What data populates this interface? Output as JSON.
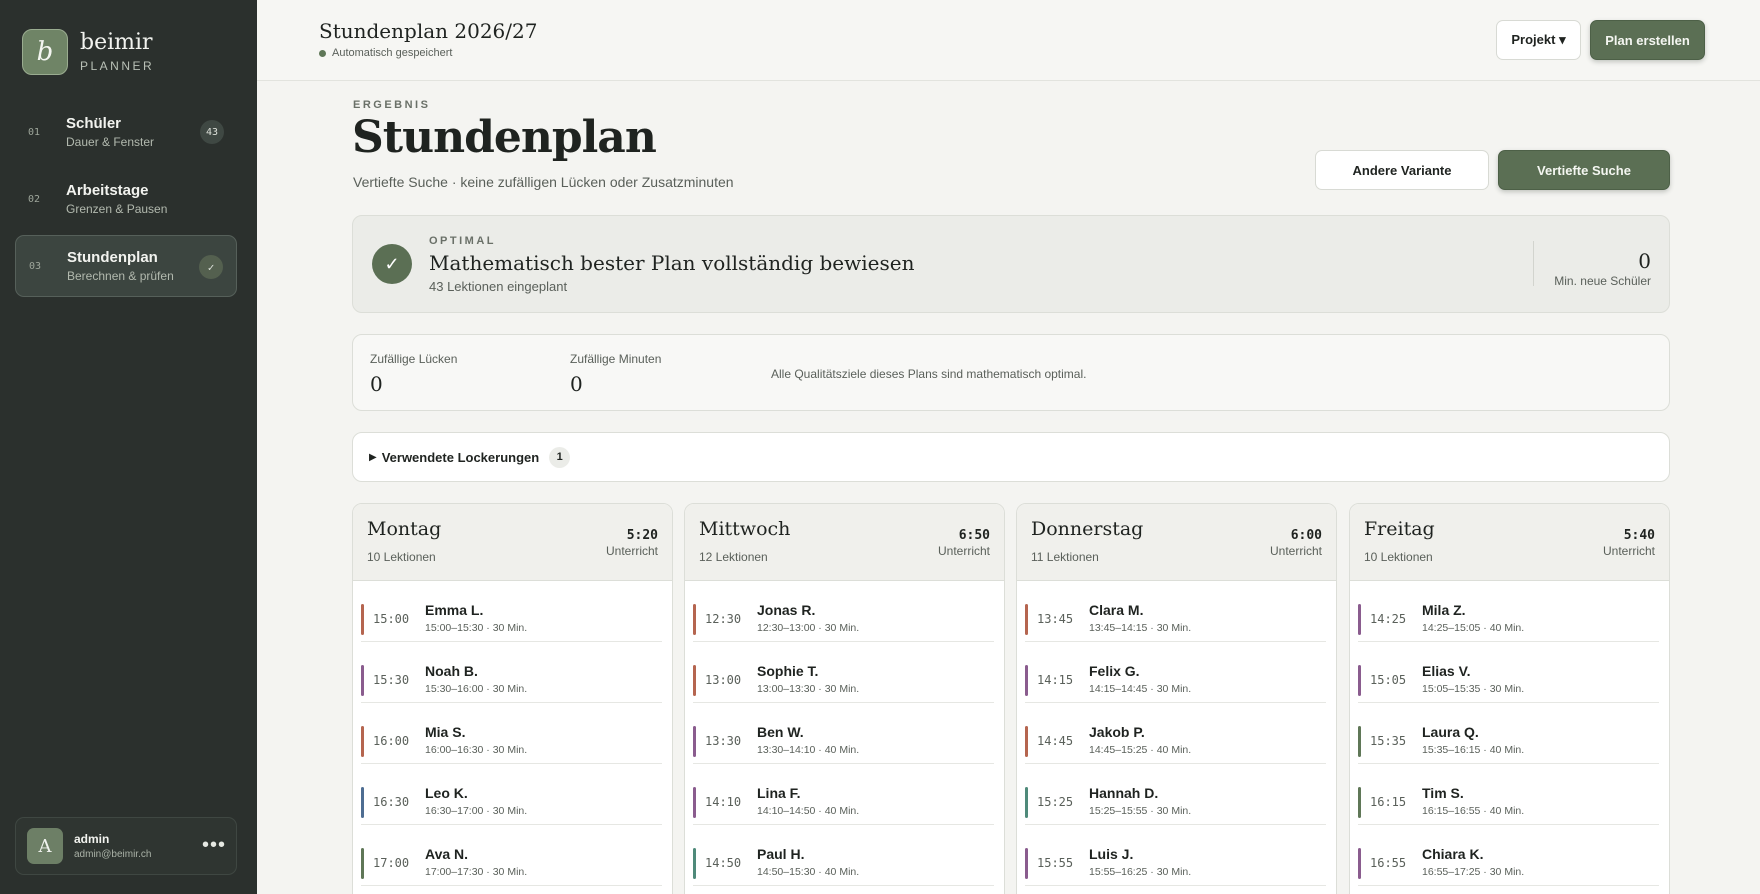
{
  "brand": {
    "logo_letter": "b",
    "name": "beimir",
    "sub": "PLANNER"
  },
  "nav": [
    {
      "num": "01",
      "title": "Schüler",
      "sub": "Dauer & Fenster",
      "badge": "43"
    },
    {
      "num": "02",
      "title": "Arbeitstage",
      "sub": "Grenzen & Pausen",
      "badge": ""
    },
    {
      "num": "03",
      "title": "Stundenplan",
      "sub": "Berechnen & prüfen",
      "badge": "✓"
    }
  ],
  "user": {
    "initial": "A",
    "name": "admin",
    "email": "admin@beimir.ch",
    "more": "•••"
  },
  "topbar": {
    "title": "Stundenplan 2026/27",
    "autosave": "Automatisch gespeichert",
    "project_btn": "Projekt ▾",
    "create_btn": "Plan erstellen"
  },
  "header": {
    "eyebrow": "ERGEBNIS",
    "title": "Stundenplan",
    "subtitle": "Vertiefte Suche · keine zufälligen Lücken oder Zusatzminuten",
    "alt_btn": "Andere Variante",
    "deep_btn": "Vertiefte Suche"
  },
  "optimal": {
    "check": "✓",
    "eyebrow": "OPTIMAL",
    "title": "Mathematisch bester Plan vollständig bewiesen",
    "sub": "43 Lektionen eingeplant",
    "value": "0",
    "value_label": "Min. neue Schüler"
  },
  "metrics": {
    "gaps_label": "Zufällige Lücken",
    "gaps_value": "0",
    "minutes_label": "Zufällige Minuten",
    "minutes_value": "0",
    "note": "Alle Qualitätsziele dieses Plans sind mathematisch optimal."
  },
  "relax": {
    "arrow": "▶",
    "label": "Verwendete Lockerungen",
    "count": "1"
  },
  "days": [
    {
      "name": "Montag",
      "count": "10 Lektionen",
      "total": "5:20",
      "total_label": "Unterricht",
      "lessons": [
        {
          "time": "15:00",
          "name": "Emma L.",
          "detail": "15:00–15:30 · 30 Min.",
          "color": "#b5654f"
        },
        {
          "time": "15:30",
          "name": "Noah B.",
          "detail": "15:30–16:00 · 30 Min.",
          "color": "#8a5c8e"
        },
        {
          "time": "16:00",
          "name": "Mia S.",
          "detail": "16:00–16:30 · 30 Min.",
          "color": "#b5654f"
        },
        {
          "time": "16:30",
          "name": "Leo K.",
          "detail": "16:30–17:00 · 30 Min.",
          "color": "#4e6d92"
        },
        {
          "time": "17:00",
          "name": "Ava N.",
          "detail": "17:00–17:30 · 30 Min.",
          "color": "#5f7757"
        }
      ]
    },
    {
      "name": "Mittwoch",
      "count": "12 Lektionen",
      "total": "6:50",
      "total_label": "Unterricht",
      "lessons": [
        {
          "time": "12:30",
          "name": "Jonas R.",
          "detail": "12:30–13:00 · 30 Min.",
          "color": "#b5654f"
        },
        {
          "time": "13:00",
          "name": "Sophie T.",
          "detail": "13:00–13:30 · 30 Min.",
          "color": "#b5654f"
        },
        {
          "time": "13:30",
          "name": "Ben W.",
          "detail": "13:30–14:10 · 40 Min.",
          "color": "#8a5c8e"
        },
        {
          "time": "14:10",
          "name": "Lina F.",
          "detail": "14:10–14:50 · 40 Min.",
          "color": "#8a5c8e"
        },
        {
          "time": "14:50",
          "name": "Paul H.",
          "detail": "14:50–15:30 · 40 Min.",
          "color": "#4f8a7a"
        }
      ]
    },
    {
      "name": "Donnerstag",
      "count": "11 Lektionen",
      "total": "6:00",
      "total_label": "Unterricht",
      "lessons": [
        {
          "time": "13:45",
          "name": "Clara M.",
          "detail": "13:45–14:15 · 30 Min.",
          "color": "#b5654f"
        },
        {
          "time": "14:15",
          "name": "Felix G.",
          "detail": "14:15–14:45 · 30 Min.",
          "color": "#8a5c8e"
        },
        {
          "time": "14:45",
          "name": "Jakob P.",
          "detail": "14:45–15:25 · 40 Min.",
          "color": "#b5654f"
        },
        {
          "time": "15:25",
          "name": "Hannah D.",
          "detail": "15:25–15:55 · 30 Min.",
          "color": "#4f8a7a"
        },
        {
          "time": "15:55",
          "name": "Luis J.",
          "detail": "15:55–16:25 · 30 Min.",
          "color": "#8a5c8e"
        }
      ]
    },
    {
      "name": "Freitag",
      "count": "10 Lektionen",
      "total": "5:40",
      "total_label": "Unterricht",
      "lessons": [
        {
          "time": "14:25",
          "name": "Mila Z.",
          "detail": "14:25–15:05 · 40 Min.",
          "color": "#8a5c8e"
        },
        {
          "time": "15:05",
          "name": "Elias V.",
          "detail": "15:05–15:35 · 30 Min.",
          "color": "#8a5c8e"
        },
        {
          "time": "15:35",
          "name": "Laura Q.",
          "detail": "15:35–16:15 · 40 Min.",
          "color": "#5f7757"
        },
        {
          "time": "16:15",
          "name": "Tim S.",
          "detail": "16:15–16:55 · 40 Min.",
          "color": "#5f7757"
        },
        {
          "time": "16:55",
          "name": "Chiara K.",
          "detail": "16:55–17:25 · 30 Min.",
          "color": "#8a5c8e"
        }
      ]
    }
  ]
}
